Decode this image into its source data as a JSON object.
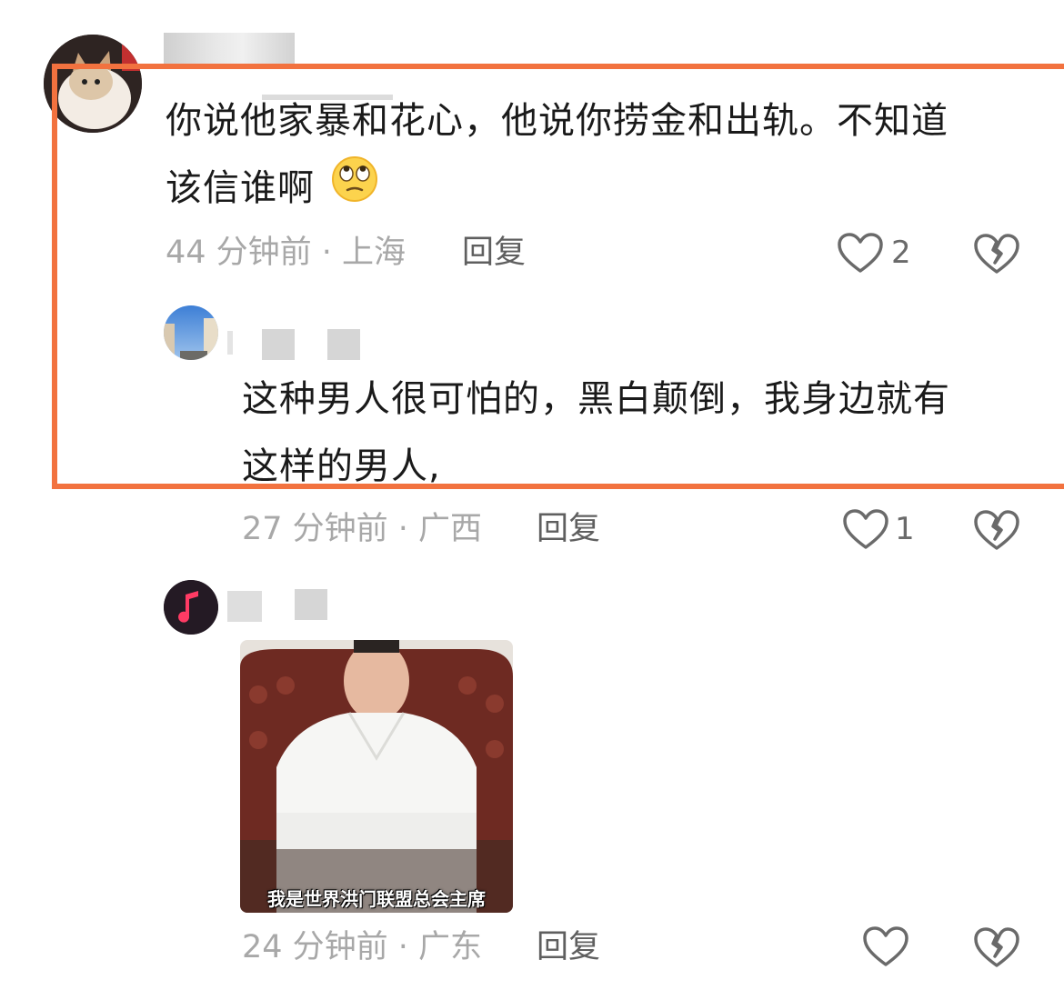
{
  "comments": [
    {
      "text_line1": "你说他家暴和花心，他说你捞金和出轨。不知道",
      "text_line2": "该信谁啊",
      "time_location": "44 分钟前 · 上海",
      "reply_label": "回复",
      "like_count": "2"
    },
    {
      "text_line1": "这种男人很可怕的，黑白颠倒，我身边就有",
      "text_line2": "这样的男人,",
      "time_location": "27 分钟前 · 广西",
      "reply_label": "回复",
      "like_count": "1"
    },
    {
      "image_caption": "我是世界洪门联盟总会主席",
      "time_location": "24 分钟前 · 广东",
      "reply_label": "回复"
    }
  ],
  "colors": {
    "highlight_frame": "#f2723f",
    "meta_text": "#a8a8a8"
  },
  "icons": [
    "heart-icon",
    "broken-heart-icon",
    "eye-roll-emoji",
    "music-note-icon"
  ]
}
